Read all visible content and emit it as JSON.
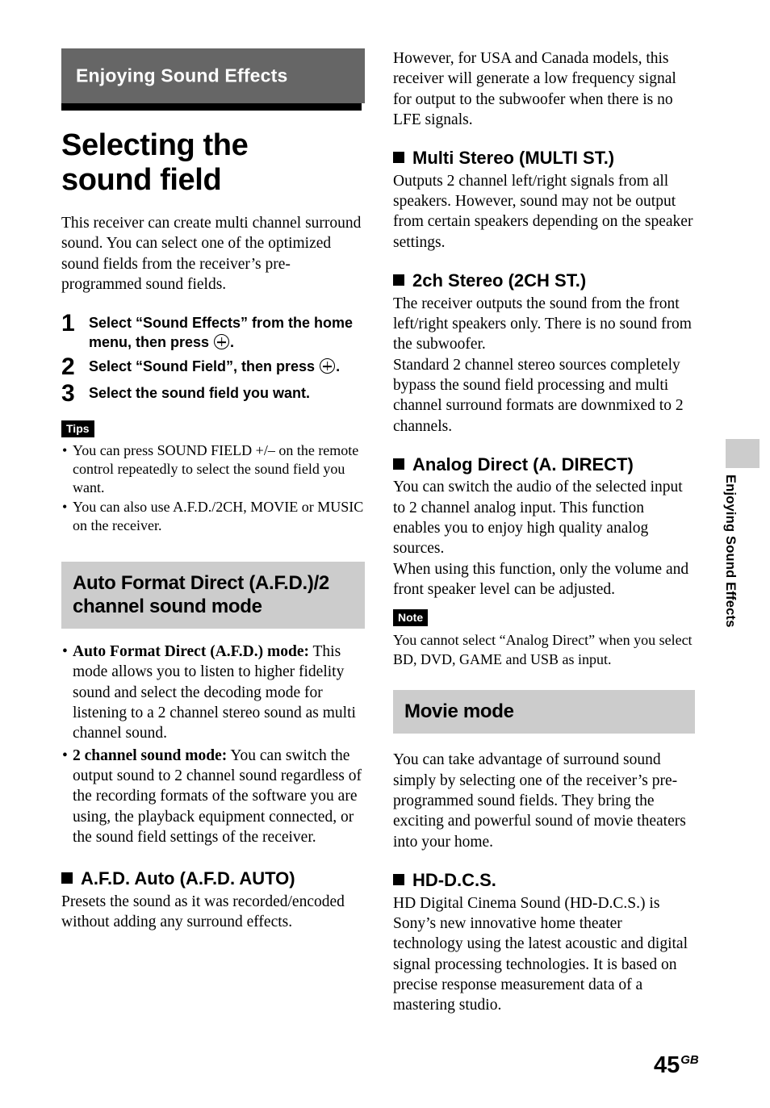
{
  "chapter": {
    "banner_label": "Enjoying Sound Effects",
    "side_tab_label": "Enjoying Sound Effects"
  },
  "title": "Selecting the sound field",
  "intro": "This receiver can create multi channel surround sound. You can select one of the optimized sound fields from the receiver’s pre-programmed sound fields.",
  "steps": [
    {
      "num": "1",
      "pre": "Select “Sound Effects” from the home menu, then press ",
      "post": "."
    },
    {
      "num": "2",
      "pre": "Select “Sound Field”, then press ",
      "post": "."
    },
    {
      "num": "3",
      "pre": "Select the sound field you want.",
      "post": ""
    }
  ],
  "tips": {
    "badge": "Tips",
    "items": [
      "You can press SOUND FIELD +/– on the remote control repeatedly to select the sound field you want.",
      "You can also use A.F.D./2CH, MOVIE or MUSIC on the receiver."
    ]
  },
  "afd_section": {
    "heading": "Auto Format Direct (A.F.D.)/2 channel sound mode",
    "bullets": [
      {
        "lead": "Auto Format Direct (A.F.D.) mode:",
        "body": " This mode allows you to listen to higher fidelity sound and select the decoding mode for listening to a 2 channel stereo sound as multi channel sound."
      },
      {
        "lead": "2 channel sound mode:",
        "body": " You can switch the output sound to 2 channel sound regardless of the recording formats of the software you are using, the playback equipment connected, or the sound field settings of the receiver."
      }
    ]
  },
  "afd_auto": {
    "heading": "A.F.D. Auto (A.F.D. AUTO)",
    "body": "Presets the sound as it was recorded/encoded without adding any surround effects."
  },
  "right_column": {
    "continuation": "However, for USA and Canada models, this receiver will generate a low frequency signal for output to the subwoofer when there is no LFE signals.",
    "multi_stereo": {
      "heading": "Multi Stereo (MULTI ST.)",
      "body": "Outputs 2 channel left/right signals from all speakers. However, sound may not be output from certain speakers depending on the speaker settings."
    },
    "two_ch_stereo": {
      "heading": "2ch Stereo (2CH ST.)",
      "body1": "The receiver outputs the sound from the front left/right speakers only. There is no sound from the subwoofer.",
      "body2": "Standard 2 channel stereo sources completely bypass the sound field processing and multi channel surround formats are downmixed to 2 channels."
    },
    "analog_direct": {
      "heading": "Analog Direct (A. DIRECT)",
      "body1": "You can switch the audio of the selected input to 2 channel analog input. This function enables you to enjoy high quality analog sources.",
      "body2": "When using this function, only the volume and front speaker level can be adjusted.",
      "note_badge": "Note",
      "note_body": "You cannot select “Analog Direct” when you select BD, DVD, GAME and USB as input."
    },
    "movie_mode": {
      "heading": "Movie mode",
      "body": "You can take advantage of surround sound simply by selecting one of the receiver’s pre-programmed sound fields. They bring the exciting and powerful sound of movie theaters into your home."
    },
    "hd_dcs": {
      "heading": "HD-D.C.S.",
      "body": "HD Digital Cinema Sound (HD-D.C.S.) is Sony’s new innovative home theater technology using the latest acoustic and digital signal processing technologies. It is based on precise response measurement data of a mastering studio."
    }
  },
  "footer": {
    "page_number": "45",
    "page_suffix": "GB"
  },
  "colors": {
    "banner_gray": "#666666",
    "section_gray": "#cccccc",
    "rule_black": "#000000"
  }
}
